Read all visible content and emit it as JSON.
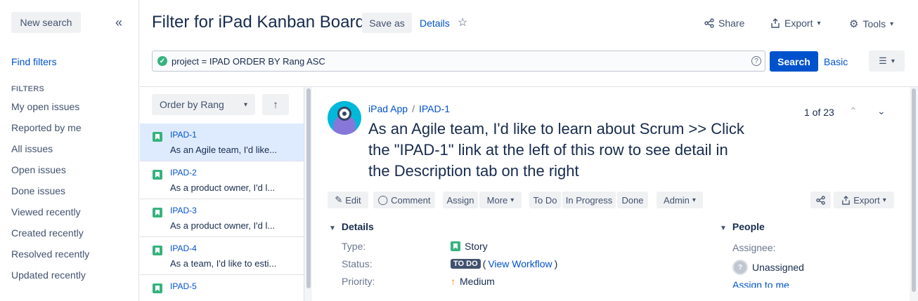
{
  "sidebar": {
    "new_search": "New search",
    "collapse_icon": "double-chevron-left-icon",
    "find_filters": "Find filters",
    "filters_heading": "FILTERS",
    "filters": [
      "My open issues",
      "Reported by me",
      "All issues",
      "Open issues",
      "Done issues",
      "Viewed recently",
      "Created recently",
      "Resolved recently",
      "Updated recently"
    ]
  },
  "header": {
    "title": "Filter for iPad Kanban Board",
    "save_as": "Save as",
    "details": "Details",
    "share": "Share",
    "export": "Export",
    "tools": "Tools"
  },
  "search": {
    "jql": "project = IPAD ORDER BY Rang ASC",
    "search_button": "Search",
    "basic": "Basic"
  },
  "list": {
    "order_by": "Order by Rang",
    "issues": [
      {
        "key": "IPAD-1",
        "summary": "As an Agile team, I'd like..."
      },
      {
        "key": "IPAD-2",
        "summary": "As a product owner, I'd l..."
      },
      {
        "key": "IPAD-3",
        "summary": "As a product owner, I'd l..."
      },
      {
        "key": "IPAD-4",
        "summary": "As a team, I'd like to esti..."
      },
      {
        "key": "IPAD-5",
        "summary": ""
      }
    ]
  },
  "issue": {
    "project": "iPad App",
    "key": "IPAD-1",
    "title": "As an Agile team, I'd like to learn about Scrum >> Click the \"IPAD-1\" link at the left of this row to see detail in the Description tab on the right",
    "pager": "1 of 23",
    "toolbar": {
      "edit": "Edit",
      "comment": "Comment",
      "assign": "Assign",
      "more": "More",
      "to_do": "To Do",
      "in_progress": "In Progress",
      "done": "Done",
      "admin": "Admin",
      "export": "Export"
    },
    "details": {
      "heading": "Details",
      "type_label": "Type:",
      "type_value": "Story",
      "status_label": "Status:",
      "status_value": "TO DO",
      "view_workflow": "View Workflow",
      "priority_label": "Priority:",
      "priority_value": "Medium"
    },
    "people": {
      "heading": "People",
      "assignee_label": "Assignee:",
      "assignee_value": "Unassigned",
      "assign_to_me": "Assign to me"
    }
  },
  "colors": {
    "primary": "#0052cc",
    "story": "#36b37e",
    "selected_row": "#deebff",
    "priority_medium": "#ff8b00"
  }
}
